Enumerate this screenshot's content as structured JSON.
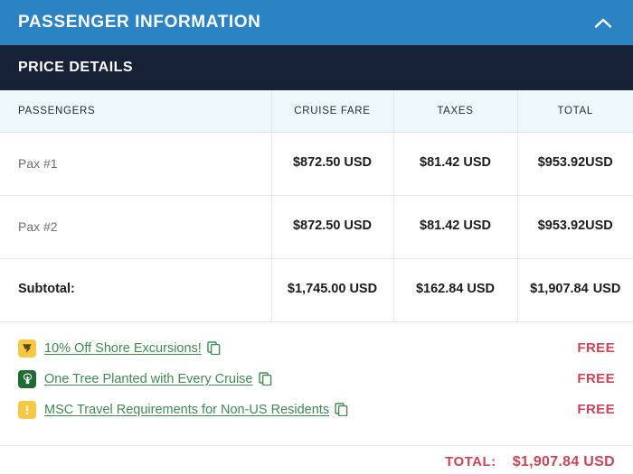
{
  "panel": {
    "title": "PASSENGER INFORMATION",
    "collapse_icon": "chevron-up-icon",
    "header_color": "#2b83c3"
  },
  "section": {
    "title": "PRICE DETAILS",
    "header_color": "#182236"
  },
  "table": {
    "columns": [
      "PASSENGERS",
      "CRUISE FARE",
      "TAXES",
      "TOTAL"
    ],
    "rows": [
      {
        "label": "Pax #1",
        "cruise_fare": "$872.50 USD",
        "taxes": "$81.42 USD",
        "total": "$953.92USD"
      },
      {
        "label": "Pax #2",
        "cruise_fare": "$872.50 USD",
        "taxes": "$81.42 USD",
        "total": "$953.92USD"
      }
    ],
    "subtotal": {
      "label": "Subtotal:",
      "cruise_fare": "$1,745.00 USD",
      "taxes": "$162.84 USD",
      "total_amount": "$1,907.84",
      "total_currency": "USD"
    }
  },
  "perks": {
    "price_color": "#c8455a",
    "link_color": "#3f8a52",
    "items": [
      {
        "icon": "shore-excursion-tag-icon",
        "icon_style": "gold",
        "label": "10% Off Shore Excursions!",
        "copy_icon": "copy-icon",
        "price": "FREE"
      },
      {
        "icon": "tree-icon",
        "icon_style": "green",
        "label": "One Tree Planted with Every Cruise",
        "copy_icon": "copy-icon",
        "price": "FREE"
      },
      {
        "icon": "exclamation-icon",
        "icon_style": "gold",
        "label": "MSC Travel Requirements for Non-US Residents",
        "copy_icon": "copy-icon",
        "price": "FREE"
      }
    ]
  },
  "grand_total": {
    "label": "TOTAL:",
    "value": "$1,907.84  USD",
    "color": "#c8455a"
  }
}
